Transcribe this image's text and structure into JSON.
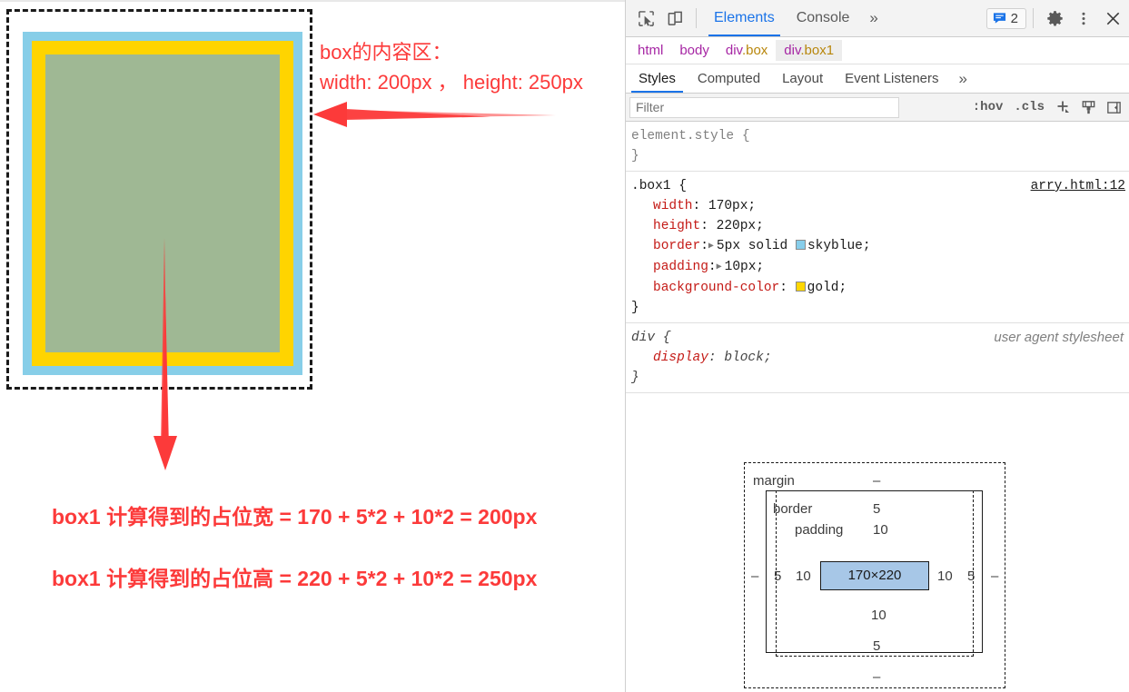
{
  "page": {
    "annotations": {
      "content_title": "box的内容区：",
      "content_dims": "width: 200px ， height: 250px",
      "calc_width": "box1 计算得到的占位宽 = 170 + 5*2 + 10*2 = 200px",
      "calc_height": "box1 计算得到的占位高 = 220 + 5*2 + 10*2 = 250px"
    },
    "box_colors": {
      "border": "#87cee8",
      "padding": "#ffd400",
      "content": "#9fb894",
      "outline": "#1a1a1a",
      "annotation": "#fc3a3a"
    }
  },
  "devtools": {
    "toolbar": {
      "inspect_icon": "inspect-cursor-icon",
      "device_icon": "device-toolbar-icon",
      "tabs": [
        {
          "label": "Elements",
          "active": true
        },
        {
          "label": "Console",
          "active": false
        }
      ],
      "more_tabs": "»",
      "message_count": "2",
      "message_icon": "message-icon",
      "settings_icon": "gear-icon",
      "menu_icon": "kebab-menu-icon",
      "close_icon": "close-icon"
    },
    "breadcrumb": [
      {
        "tag": "html",
        "cls": "",
        "selected": false
      },
      {
        "tag": "body",
        "cls": "",
        "selected": false
      },
      {
        "tag": "div",
        "cls": ".box",
        "selected": false
      },
      {
        "tag": "div",
        "cls": ".box1",
        "selected": true
      }
    ],
    "subtabs": [
      {
        "label": "Styles",
        "active": true
      },
      {
        "label": "Computed",
        "active": false
      },
      {
        "label": "Layout",
        "active": false
      },
      {
        "label": "Event Listeners",
        "active": false
      }
    ],
    "subtabs_more": "»",
    "filter": {
      "placeholder": "Filter",
      "value": "",
      "hov_label": ":hov",
      "cls_label": ".cls",
      "new_rule_icon": "plus-icon",
      "styles_icon": "paintbrush-icon",
      "sidebar_toggle_icon": "sidebar-toggle-icon"
    },
    "rules": {
      "element_style": {
        "selector": "element.style {",
        "close": "}"
      },
      "box1": {
        "selector": ".box1 {",
        "source": "arry.html:12",
        "close": "}",
        "declarations": [
          {
            "prop": "width",
            "value": "170px;",
            "swatch": "",
            "expandable": false
          },
          {
            "prop": "height",
            "value": "220px;",
            "swatch": "",
            "expandable": false
          },
          {
            "prop": "border",
            "value": "5px solid",
            "swatch": "#87ceeb",
            "swatch_text": "skyblue;",
            "expandable": true
          },
          {
            "prop": "padding",
            "value": "10px;",
            "swatch": "",
            "expandable": true
          },
          {
            "prop": "background-color",
            "value": "",
            "swatch": "#ffd700",
            "swatch_text": "gold;",
            "expandable": false
          }
        ]
      },
      "div_ua": {
        "selector": "div {",
        "origin": "user agent stylesheet",
        "close": "}",
        "declarations": [
          {
            "prop": "display",
            "value": "block;"
          }
        ]
      }
    },
    "box_model": {
      "margin_label": "margin",
      "border_label": "border",
      "padding_label": "padding",
      "content_size": "170×220",
      "margin_top": "–",
      "margin_right": "–",
      "margin_bottom": "–",
      "margin_left": "–",
      "border_top": "5",
      "border_right": "5",
      "border_bottom": "5",
      "border_left": "5",
      "padding_top": "10",
      "padding_right": "10",
      "padding_bottom": "10",
      "padding_left": "10",
      "content_fill": "#a7c7e7"
    }
  }
}
